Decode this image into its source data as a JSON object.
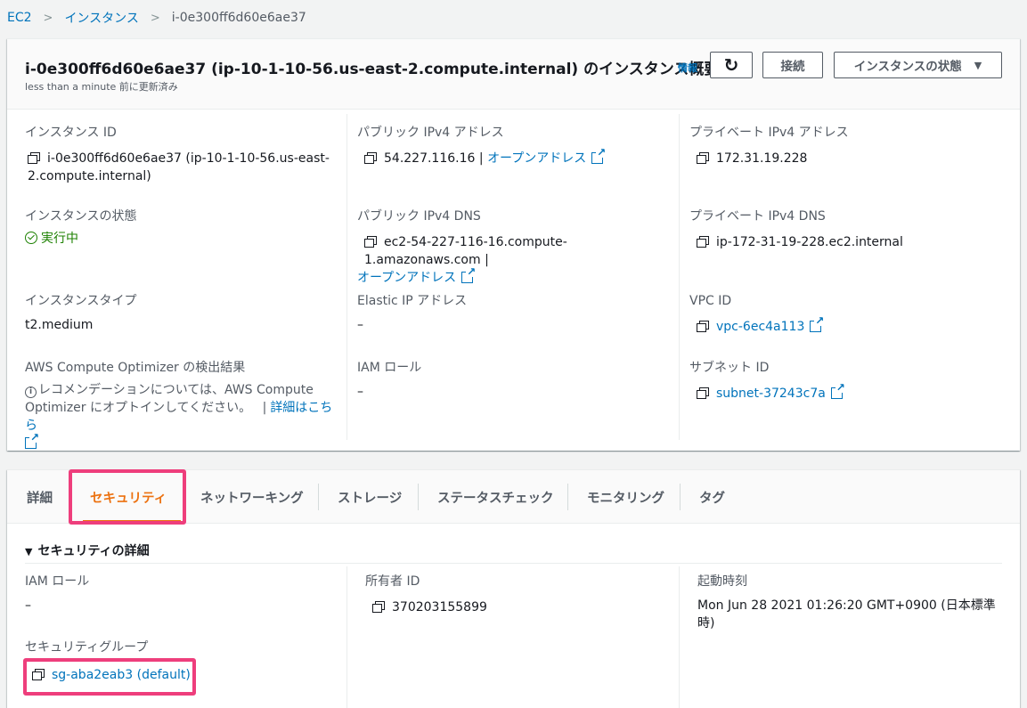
{
  "breadcrumb": {
    "items": [
      "EC2",
      "インスタンス"
    ],
    "current": "i-0e300ff6d60e6ae37"
  },
  "header": {
    "title": "i-0e300ff6d60e6ae37 (ip-10-1-10-56.us-east-2.compute.internal) のインスタンス概要",
    "info_link": "情報",
    "subtitle": "less than a minute 前に更新済み",
    "refresh_icon": "↻",
    "connect_label": "接続",
    "state_label": "インスタンスの状態",
    "state_caret": "▼"
  },
  "summary": {
    "instance_id": {
      "label": "インスタンス ID",
      "value": "i-0e300ff6d60e6ae37 (ip-10-1-10-56.us-east-2.compute.internal)"
    },
    "instance_state": {
      "label": "インスタンスの状態",
      "value": "実行中"
    },
    "instance_type": {
      "label": "インスタンスタイプ",
      "value": "t2.medium"
    },
    "optimizer": {
      "label": "AWS Compute Optimizer の検出結果",
      "text": "レコメンデーションについては、AWS Compute Optimizer にオプトインしてください。",
      "sep": "|",
      "link": "詳細はこちら"
    },
    "public_ipv4": {
      "label": "パブリック IPv4 アドレス",
      "value": "54.227.116.16",
      "sep": "|",
      "link": "オープンアドレス"
    },
    "public_dns": {
      "label": "パブリック IPv4 DNS",
      "value": "ec2-54-227-116-16.compute-1.amazonaws.com",
      "sep": "|",
      "link": "オープンアドレス"
    },
    "elastic_ip": {
      "label": "Elastic IP アドレス",
      "value": "–"
    },
    "iam_role": {
      "label": "IAM ロール",
      "value": "–"
    },
    "private_ipv4": {
      "label": "プライベート IPv4 アドレス",
      "value": "172.31.19.228"
    },
    "private_dns": {
      "label": "プライベート IPv4 DNS",
      "value": "ip-172-31-19-228.ec2.internal"
    },
    "vpc_id": {
      "label": "VPC ID",
      "value": "vpc-6ec4a113"
    },
    "subnet_id": {
      "label": "サブネット ID",
      "value": "subnet-37243c7a"
    }
  },
  "tabs": [
    "詳細",
    "セキュリティ",
    "ネットワーキング",
    "ストレージ",
    "ステータスチェック",
    "モニタリング",
    "タグ"
  ],
  "active_tab": "セキュリティ",
  "security": {
    "title": "セキュリティの詳細",
    "iam_role": {
      "label": "IAM ロール",
      "value": "–"
    },
    "security_group": {
      "label": "セキュリティグループ",
      "value": "sg-aba2eab3 (default)"
    },
    "owner_id": {
      "label": "所有者 ID",
      "value": "370203155899"
    },
    "launch_time": {
      "label": "起動時刻",
      "value": "Mon Jun 28 2021 01:26:20 GMT+0900 (日本標準時)"
    }
  },
  "colors": {
    "accent": "#ec7211",
    "link": "#0073bb",
    "highlight": "#ee3e7c",
    "success": "#1d8102"
  }
}
